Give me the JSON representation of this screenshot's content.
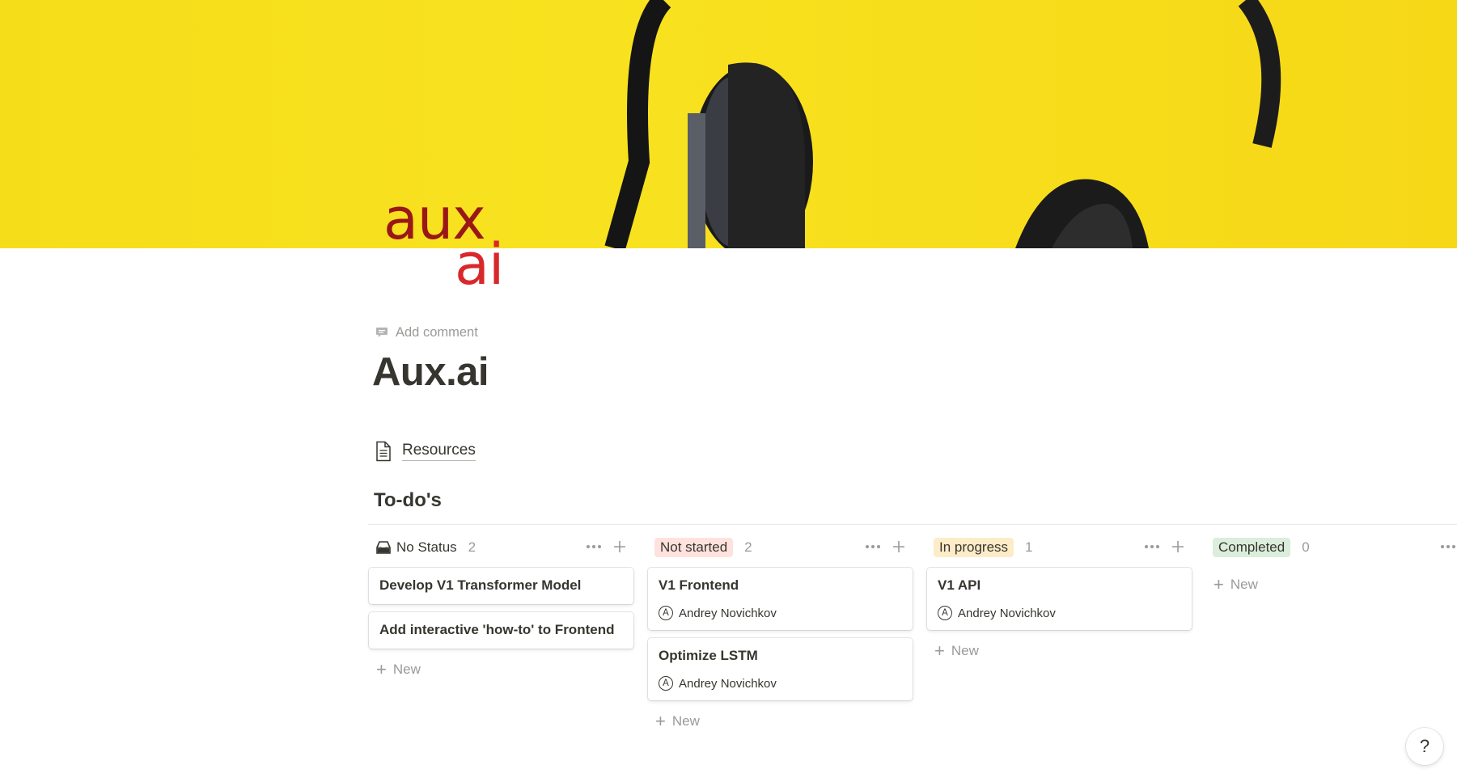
{
  "page": {
    "logo_line1": "aux",
    "logo_line2": "ai",
    "add_comment": "Add comment",
    "title": "Aux.ai",
    "resources_link": "Resources",
    "section_title": "To-do's",
    "help": "?"
  },
  "board": {
    "columns": [
      {
        "status": "No Status",
        "count": "2",
        "color": "#ffffff",
        "cards": [
          {
            "title": "Develop V1 Transformer Model"
          },
          {
            "title": "Add interactive 'how-to' to Frontend"
          }
        ],
        "new_label": "New"
      },
      {
        "status": "Not started",
        "count": "2",
        "color": "#ffe2dd",
        "cards": [
          {
            "title": "V1 Frontend",
            "assignee": "Andrey Novichkov",
            "avatar_letter": "A"
          },
          {
            "title": "Optimize LSTM",
            "assignee": "Andrey Novichkov",
            "avatar_letter": "A"
          }
        ],
        "new_label": "New"
      },
      {
        "status": "In progress",
        "count": "1",
        "color": "#fdecc8",
        "cards": [
          {
            "title": "V1 API",
            "assignee": "Andrey Novichkov",
            "avatar_letter": "A"
          }
        ],
        "new_label": "New"
      },
      {
        "status": "Completed",
        "count": "0",
        "color": "#dbeddb",
        "cards": [],
        "new_label": "New"
      }
    ]
  },
  "colors": {
    "cover_yellow": "#f7dc19",
    "logo_dark_red": "#9a1717",
    "logo_red": "#d9282b",
    "text": "#37352f",
    "muted": "#9b9a97"
  }
}
